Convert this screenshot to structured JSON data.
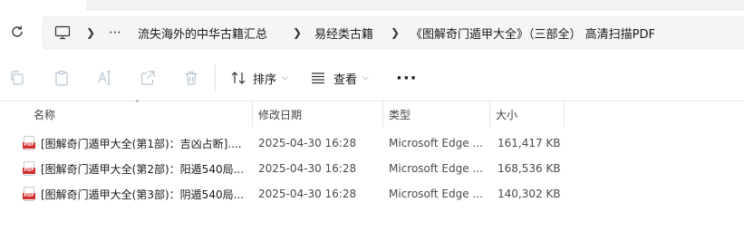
{
  "breadcrumb": {
    "ellipsis": "⋯",
    "items": [
      "流失海外的中华古籍汇总",
      "易经类古籍",
      "《图解奇门遁甲大全》（三部全） 高清扫描PDF"
    ]
  },
  "toolbar": {
    "sort_label": "排序",
    "view_label": "查看",
    "more_label": "···"
  },
  "columns": {
    "name": "名称",
    "modified": "修改日期",
    "type": "类型",
    "size": "大小"
  },
  "files": [
    {
      "name": "[图解奇门遁甲大全(第1部)：吉凶占断]....",
      "modified": "2025-04-30 16:28",
      "type": "Microsoft Edge ...",
      "size": "161,417 KB"
    },
    {
      "name": "[图解奇门遁甲大全(第2部)：阳遁540局...",
      "modified": "2025-04-30 16:28",
      "type": "Microsoft Edge ...",
      "size": "168,536 KB"
    },
    {
      "name": "[图解奇门遁甲大全(第3部)：阴遁540局...",
      "modified": "2025-04-30 16:28",
      "type": "Microsoft Edge ...",
      "size": "140,302 KB"
    }
  ],
  "icons": {
    "refresh": "refresh-icon",
    "computer": "computer-icon",
    "copy": "copy-icon",
    "paste": "paste-icon",
    "rename": "rename-icon",
    "share": "share-icon",
    "delete": "delete-icon",
    "sort": "sort-icon",
    "view": "view-icon",
    "file": "pdf-file-icon"
  },
  "colors": {
    "pdf_badge": "#d32f2f",
    "disabled_icon": "#b8c4d0"
  }
}
